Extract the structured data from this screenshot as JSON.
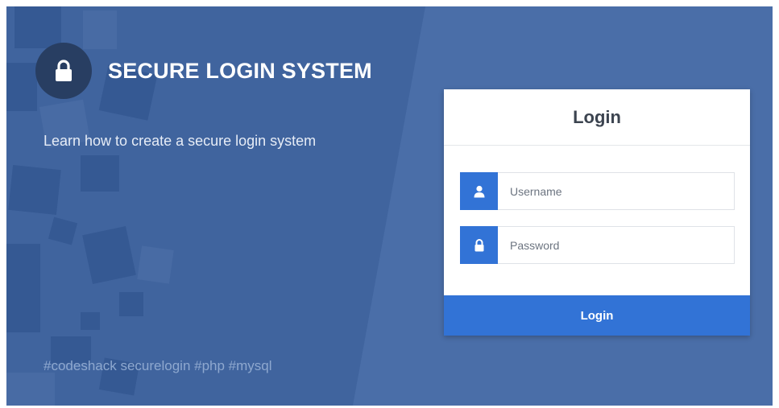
{
  "brand": {
    "title": "SECURE LOGIN SYSTEM",
    "icon": "lock-icon"
  },
  "tagline": "Learn how to create a secure login system",
  "hashtags": "#codeshack securelogin #php #mysql",
  "login": {
    "heading": "Login",
    "username": {
      "placeholder": "Username",
      "value": "",
      "icon": "user-icon"
    },
    "password": {
      "placeholder": "Password",
      "value": "",
      "icon": "lock-icon"
    },
    "submit_label": "Login"
  },
  "colors": {
    "background": "#4a6ea8",
    "panel": "#40649e",
    "accent": "#3273d6",
    "brand_circle": "#283e62",
    "card": "#ffffff"
  }
}
